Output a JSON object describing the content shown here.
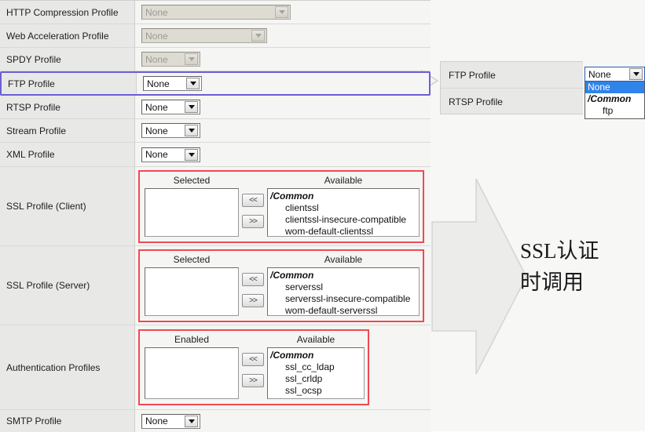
{
  "form": {
    "rows": [
      {
        "label": "HTTP Compression Profile",
        "control": "select",
        "value": "None",
        "disabled": true,
        "width": "w190"
      },
      {
        "label": "Web Acceleration Profile",
        "control": "select",
        "value": "None",
        "disabled": true,
        "width": "w160"
      },
      {
        "label": "SPDY Profile",
        "control": "select",
        "value": "None",
        "disabled": true,
        "width": "w75"
      },
      {
        "label": "FTP Profile",
        "control": "select",
        "value": "None",
        "disabled": false,
        "width": "w75",
        "highlighted": true
      },
      {
        "label": "RTSP Profile",
        "control": "select",
        "value": "None",
        "disabled": false,
        "width": "w75"
      },
      {
        "label": "Stream Profile",
        "control": "select",
        "value": "None",
        "disabled": false,
        "width": "w75"
      },
      {
        "label": "XML Profile",
        "control": "select",
        "value": "None",
        "disabled": false,
        "width": "w75"
      },
      {
        "label": "SSL Profile (Client)",
        "control": "picker"
      },
      {
        "label": "SSL Profile (Server)",
        "control": "picker"
      },
      {
        "label": "Authentication Profiles",
        "control": "picker"
      },
      {
        "label": "SMTP Profile",
        "control": "select",
        "value": "None",
        "disabled": false,
        "width": "w75"
      }
    ]
  },
  "pickers": {
    "ssl_client": {
      "left_header": "Selected",
      "right_header": "Available",
      "selected_items": [],
      "available_items": [
        {
          "text": "/Common",
          "group": true
        },
        {
          "text": "clientssl",
          "group": false
        },
        {
          "text": "clientssl-insecure-compatible",
          "group": false
        },
        {
          "text": "wom-default-clientssl",
          "group": false
        }
      ],
      "move_left_label": "<<",
      "move_right_label": ">>"
    },
    "ssl_server": {
      "left_header": "Selected",
      "right_header": "Available",
      "selected_items": [],
      "available_items": [
        {
          "text": "/Common",
          "group": true
        },
        {
          "text": "serverssl",
          "group": false
        },
        {
          "text": "serverssl-insecure-compatible",
          "group": false
        },
        {
          "text": "wom-default-serverssl",
          "group": false
        }
      ],
      "move_left_label": "<<",
      "move_right_label": ">>"
    },
    "auth": {
      "left_header": "Enabled",
      "right_header": "Available",
      "selected_items": [],
      "available_items": [
        {
          "text": "/Common",
          "group": true
        },
        {
          "text": "ssl_cc_ldap",
          "group": false
        },
        {
          "text": "ssl_crldp",
          "group": false
        },
        {
          "text": "ssl_ocsp",
          "group": false
        }
      ],
      "move_left_label": "<<",
      "move_right_label": ">>"
    }
  },
  "right_panel": {
    "rows": [
      {
        "label": "FTP Profile"
      },
      {
        "label": "RTSP Profile"
      }
    ],
    "dropdown": {
      "value": "None",
      "options": [
        {
          "text": "None",
          "selected": true,
          "group": false,
          "indent": false
        },
        {
          "text": "/Common",
          "selected": false,
          "group": true,
          "indent": false
        },
        {
          "text": "ftp",
          "selected": false,
          "group": false,
          "indent": true
        }
      ]
    }
  },
  "annotation": {
    "caption_line1": "SSL认证",
    "caption_line2": "时调用"
  },
  "colors": {
    "highlight_border": "#6b5fd4",
    "callout_border": "#f04a52",
    "selection_blue": "#3083e8",
    "label_bg": "#e8e8e6",
    "field_bg": "#f5f5f3"
  }
}
